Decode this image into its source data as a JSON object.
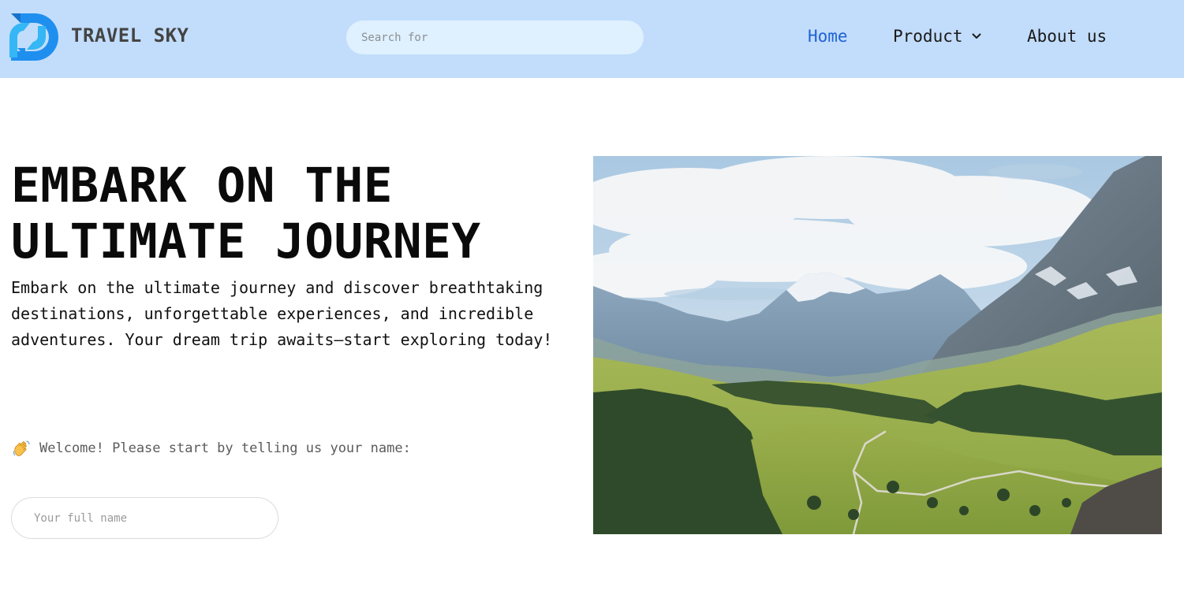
{
  "header": {
    "brand": "TRAVEL SKY",
    "logo_icon": "travel-sky-logo",
    "search_placeholder": "Search for",
    "nav": {
      "home": "Home",
      "product": "Product",
      "about": "About us"
    },
    "colors": {
      "background": "#c2ddfb",
      "active_link": "#1f62d6",
      "logo_primary": "#1f8fef"
    }
  },
  "hero": {
    "title": "EMBARK ON THE ULTIMATE JOURNEY",
    "description": "Embark on the ultimate journey and discover breathtaking destinations, unforgettable experiences, and incredible adventures. Your dream trip awaits—start exploring today!",
    "welcome_emoji": "waving-hand-icon",
    "welcome_text": "Welcome! Please start by telling us your name:",
    "name_placeholder": "Your full name",
    "image_subject": "mountain-valley-landscape-photo"
  }
}
